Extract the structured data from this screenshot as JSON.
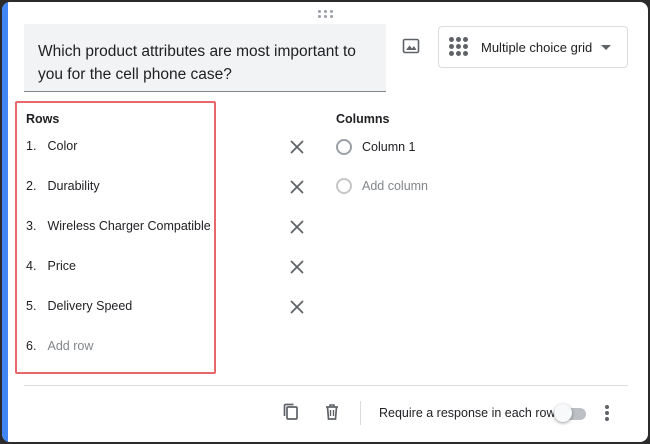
{
  "question": {
    "text": "Which product attributes are most important to you for the cell phone case?"
  },
  "question_type": {
    "selected": "Multiple choice grid",
    "icon": "grid-dots-icon"
  },
  "rows": {
    "heading": "Rows",
    "items": [
      {
        "num": "1.",
        "label": "Color"
      },
      {
        "num": "2.",
        "label": "Durability"
      },
      {
        "num": "3.",
        "label": "Wireless Charger Compatible"
      },
      {
        "num": "4.",
        "label": "Price"
      },
      {
        "num": "5.",
        "label": "Delivery Speed"
      }
    ],
    "add": {
      "num": "6.",
      "label": "Add row"
    }
  },
  "columns": {
    "heading": "Columns",
    "items": [
      {
        "label": "Column 1"
      }
    ],
    "add": {
      "label": "Add column"
    }
  },
  "footer": {
    "require_label": "Require a response in each row",
    "require_enabled": false
  },
  "colors": {
    "accent": "#4285f4",
    "highlight": "#e8676a"
  }
}
